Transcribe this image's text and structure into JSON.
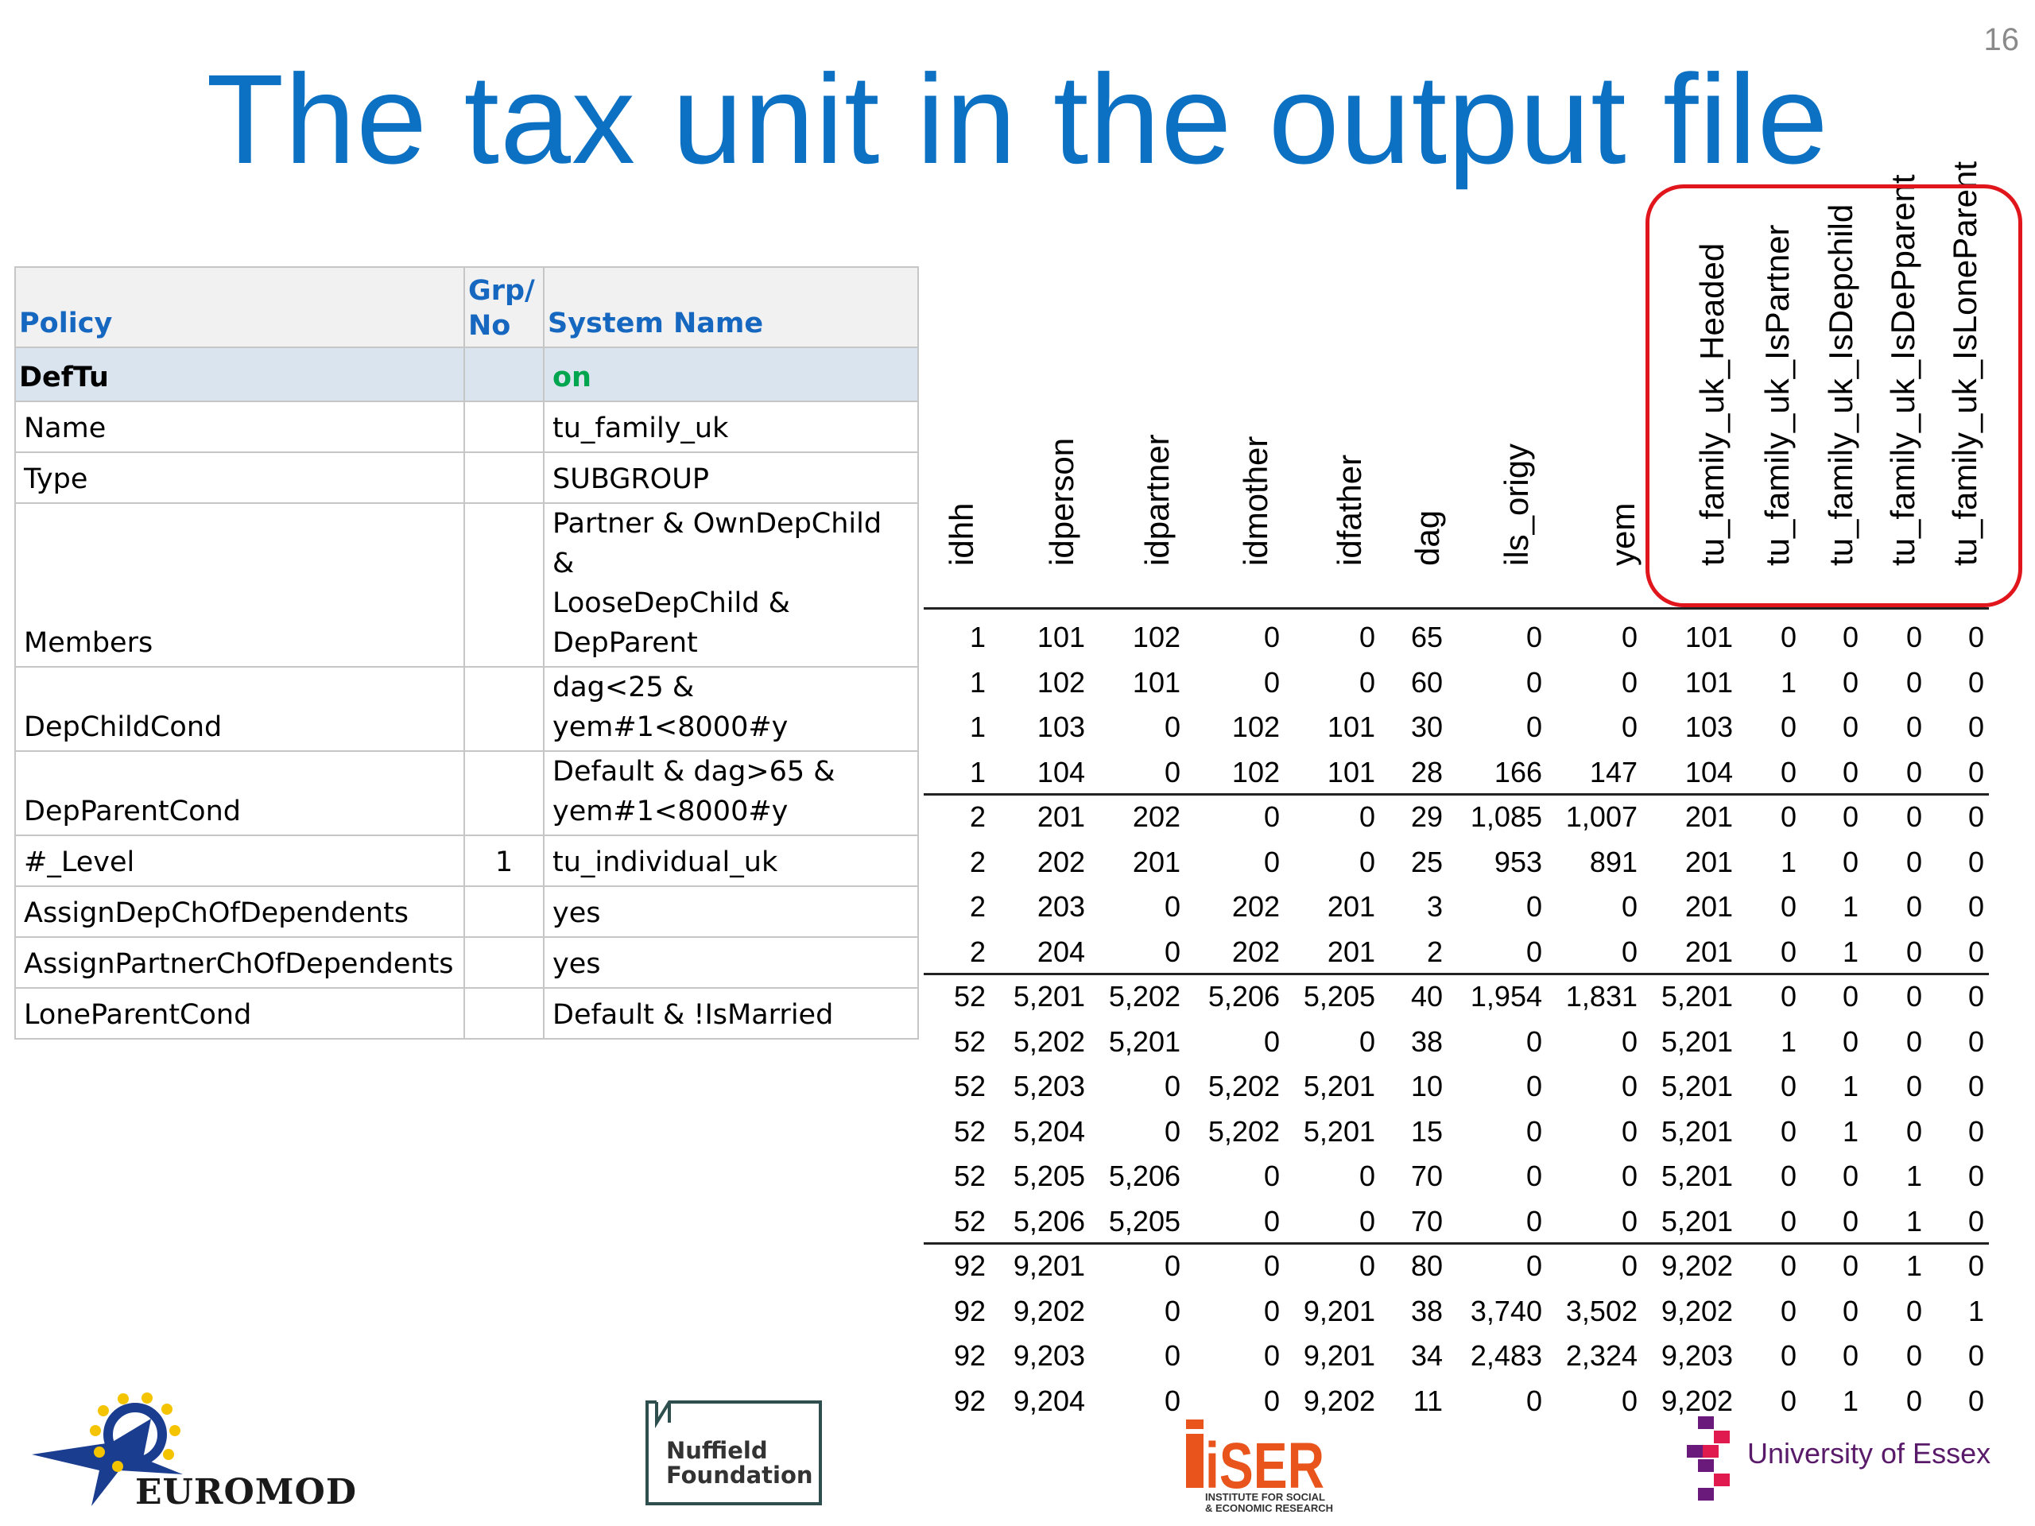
{
  "slide": {
    "number": "16",
    "title": "The tax unit in the output file"
  },
  "policy_table": {
    "headers": {
      "policy": "Policy",
      "grp": "Grp/\nNo",
      "grp_line1": "Grp/",
      "grp_line2": "No",
      "system": "System Name"
    },
    "deftu": {
      "name": "DefTu",
      "value": "on"
    },
    "rows": [
      {
        "name": "Name",
        "grp": "",
        "value": "tu_family_uk"
      },
      {
        "name": "Type",
        "grp": "",
        "value": "SUBGROUP"
      },
      {
        "name": "Members",
        "grp": "",
        "value_lines": [
          "Partner & OwnDepChild &",
          "LooseDepChild &",
          "DepParent"
        ]
      },
      {
        "name": "DepChildCond",
        "grp": "",
        "value": "dag<25 & yem#1<8000#y"
      },
      {
        "name": "DepParentCond",
        "grp": "",
        "value_lines": [
          "Default & dag>65 &",
          "yem#1<8000#y"
        ]
      },
      {
        "name": "#_Level",
        "grp": "1",
        "value": "tu_individual_uk"
      },
      {
        "name": "AssignDepChOfDependents",
        "grp": "",
        "value": "yes"
      },
      {
        "name": "AssignPartnerChOfDependents",
        "grp": "",
        "value": "yes"
      },
      {
        "name": "LoneParentCond",
        "grp": "",
        "value": "Default & !IsMarried"
      }
    ]
  },
  "data_table": {
    "columns": [
      "idhh",
      "idperson",
      "idpartner",
      "idmother",
      "idfather",
      "dag",
      "ils_origy",
      "yem",
      "tu_family_uk_Headed",
      "tu_family_uk_IsPartner",
      "tu_family_uk_IsDepchild",
      "tu_family_uk_IsDePparent",
      "tu_family_uk_IsLoneParent"
    ],
    "highlighted_columns": [
      "tu_family_uk_Headed",
      "tu_family_uk_IsPartner",
      "tu_family_uk_IsDepchild",
      "tu_family_uk_IsDePparent",
      "tu_family_uk_IsLoneParent"
    ],
    "rows": [
      [
        "1",
        "101",
        "102",
        "0",
        "0",
        "65",
        "0",
        "0",
        "101",
        "0",
        "0",
        "0",
        "0"
      ],
      [
        "1",
        "102",
        "101",
        "0",
        "0",
        "60",
        "0",
        "0",
        "101",
        "1",
        "0",
        "0",
        "0"
      ],
      [
        "1",
        "103",
        "0",
        "102",
        "101",
        "30",
        "0",
        "0",
        "103",
        "0",
        "0",
        "0",
        "0"
      ],
      [
        "1",
        "104",
        "0",
        "102",
        "101",
        "28",
        "166",
        "147",
        "104",
        "0",
        "0",
        "0",
        "0"
      ],
      [
        "2",
        "201",
        "202",
        "0",
        "0",
        "29",
        "1,085",
        "1,007",
        "201",
        "0",
        "0",
        "0",
        "0"
      ],
      [
        "2",
        "202",
        "201",
        "0",
        "0",
        "25",
        "953",
        "891",
        "201",
        "1",
        "0",
        "0",
        "0"
      ],
      [
        "2",
        "203",
        "0",
        "202",
        "201",
        "3",
        "0",
        "0",
        "201",
        "0",
        "1",
        "0",
        "0"
      ],
      [
        "2",
        "204",
        "0",
        "202",
        "201",
        "2",
        "0",
        "0",
        "201",
        "0",
        "1",
        "0",
        "0"
      ],
      [
        "52",
        "5,201",
        "5,202",
        "5,206",
        "5,205",
        "40",
        "1,954",
        "1,831",
        "5,201",
        "0",
        "0",
        "0",
        "0"
      ],
      [
        "52",
        "5,202",
        "5,201",
        "0",
        "0",
        "38",
        "0",
        "0",
        "5,201",
        "1",
        "0",
        "0",
        "0"
      ],
      [
        "52",
        "5,203",
        "0",
        "5,202",
        "5,201",
        "10",
        "0",
        "0",
        "5,201",
        "0",
        "1",
        "0",
        "0"
      ],
      [
        "52",
        "5,204",
        "0",
        "5,202",
        "5,201",
        "15",
        "0",
        "0",
        "5,201",
        "0",
        "1",
        "0",
        "0"
      ],
      [
        "52",
        "5,205",
        "5,206",
        "0",
        "0",
        "70",
        "0",
        "0",
        "5,201",
        "0",
        "0",
        "1",
        "0"
      ],
      [
        "52",
        "5,206",
        "5,205",
        "0",
        "0",
        "70",
        "0",
        "0",
        "5,201",
        "0",
        "0",
        "1",
        "0"
      ],
      [
        "92",
        "9,201",
        "0",
        "0",
        "0",
        "80",
        "0",
        "0",
        "9,202",
        "0",
        "0",
        "1",
        "0"
      ],
      [
        "92",
        "9,202",
        "0",
        "0",
        "9,201",
        "38",
        "3,740",
        "3,502",
        "9,202",
        "0",
        "0",
        "0",
        "1"
      ],
      [
        "92",
        "9,203",
        "0",
        "0",
        "9,201",
        "34",
        "2,483",
        "2,324",
        "9,203",
        "0",
        "0",
        "0",
        "0"
      ],
      [
        "92",
        "9,204",
        "0",
        "0",
        "9,202",
        "11",
        "0",
        "0",
        "9,202",
        "0",
        "1",
        "0",
        "0"
      ]
    ]
  },
  "logos": {
    "euromod": "EUROMOD",
    "nuffield_line1": "Nuffield",
    "nuffield_line2": "Foundation",
    "iser": "iSER",
    "iser_sub_line1": "INSTITUTE FOR SOCIAL",
    "iser_sub_line2": "& ECONOMIC RESEARCH",
    "essex": "University of Essex"
  },
  "colors": {
    "title": "#0c71c3",
    "header_text": "#1667c0",
    "on_value": "#00a550",
    "highlight_box": "#e0161c",
    "deftu_row_bg": "#dae4ef"
  }
}
